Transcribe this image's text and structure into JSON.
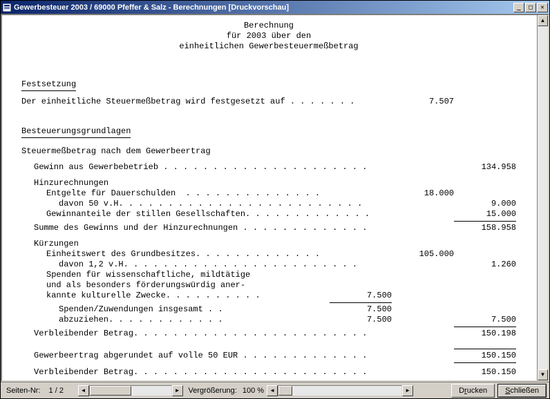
{
  "window": {
    "title": "Gewerbesteuer 2003 / 69000 Pfeffer & Salz - Berechnungen  [Druckvorschau]"
  },
  "header": {
    "line1": "Berechnung",
    "line2": "für 2003 über den",
    "line3": "einheitlichen Gewerbesteuermeßbetrag"
  },
  "section1": {
    "title": "Festsetzung",
    "line_label": "Der einheitliche Steuermeßbetrag wird festgesetzt auf . . . . . . .",
    "line_value": "7.507"
  },
  "section2": {
    "title": "Besteuerungsgrundlagen",
    "sub_label": "Steuermeßbetrag nach dem Gewerbeertrag",
    "gewinn_label": "Gewinn aus Gewerbebetrieb . . . . . . . . . . . . . . . . . . . . .",
    "gewinn_value": "134.958",
    "hinzu_label": "Hinzurechnungen",
    "entgelte_label": "Entgelte für Dauerschulden  . . . . . . . . . . . . . .",
    "entgelte_value": "18.000",
    "davon50_label": "davon 50 v.H. . . . . . . . . . . . . . . . . . . . . . . . .",
    "davon50_value": "9.000",
    "gewinnanteile_label": "Gewinnanteile der stillen Gesellschaften. . . . . . . . . . . . .",
    "gewinnanteile_value": "15.000",
    "summe_label": "Summe des Gewinns und der Hinzurechnungen . . . . . . . . . . . . .",
    "summe_value": "158.958",
    "kuerz_label": "Kürzungen",
    "einheitswert_label": "Einheitswert des Grundbesitzes. . . . . . . . . . . . .",
    "einheitswert_value": "105.000",
    "davon12_label": "davon 1,2 v.H. . . . . . . . . . . . . . . . . . . . . . . .",
    "davon12_value": "1.260",
    "spenden1": "Spenden für wissenschaftliche, mildtätige",
    "spenden2": "und als besonders förderungswürdig aner-",
    "spenden3_label": "kannte kulturelle Zwecke. . . . . . . . . .",
    "spenden3_value": "7.500",
    "spenden_ins_label": "Spenden/Zuwendungen insgesamt . .",
    "spenden_ins_value": "7.500",
    "abzuziehen_label": "abzuziehen. . . . . . . . . . . .",
    "abzuziehen_v1": "7.500",
    "abzuziehen_v2": "7.500",
    "verbleibend1_label": "Verbleibender Betrag. . . . . . . . . . . . . . . . . . . . . . . .",
    "verbleibend1_value": "150.198",
    "abgerundet_label": "Gewerbeertrag abgerundet auf volle 50 EUR . . . . . . . . . . . . .",
    "abgerundet_value": "150.150",
    "verbleibend2_label": "Verbleibender Betrag. . . . . . . . . . . . . . . . . . . . . . . .",
    "verbleibend2_value": "150.150"
  },
  "status": {
    "page_label": "Seiten-Nr:",
    "page_value": "1 / 2",
    "zoom_label": "Vergrößerung:",
    "zoom_value": "100 %",
    "print_pre": "D",
    "print_key": "r",
    "print_post": "ucken",
    "close_pre": "",
    "close_key": "S",
    "close_post": "chließen"
  }
}
